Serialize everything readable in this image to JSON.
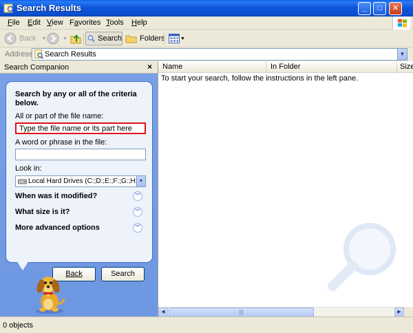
{
  "window": {
    "title": "Search Results"
  },
  "menu": {
    "items": [
      {
        "pre": "",
        "key": "F",
        "post": "ile"
      },
      {
        "pre": "",
        "key": "E",
        "post": "dit"
      },
      {
        "pre": "",
        "key": "V",
        "post": "iew"
      },
      {
        "pre": "F",
        "key": "a",
        "post": "vorites"
      },
      {
        "pre": "",
        "key": "T",
        "post": "ools"
      },
      {
        "pre": "",
        "key": "H",
        "post": "elp"
      }
    ]
  },
  "toolbar": {
    "back_label": "Back",
    "search_label": "Search",
    "folders_label": "Folders"
  },
  "address": {
    "label": "Address",
    "value": "Search Results"
  },
  "companion": {
    "title": "Search Companion",
    "close_glyph": "×",
    "heading": "Search by any or all of the criteria below.",
    "filename_label": "All or part of the file name:",
    "filename_value": "Type the file name or its part here",
    "phrase_label": "A word or phrase in the file:",
    "phrase_value": "",
    "lookin_label": "Look in:",
    "lookin_value": "Local Hard Drives (C:;D:;E:;F:;G:;H:)",
    "options": [
      "When was it modified?",
      "What size is it?",
      "More advanced options"
    ],
    "back_button": "Back",
    "search_button": "Search"
  },
  "results": {
    "columns": [
      "Name",
      "In Folder",
      "Size"
    ],
    "message": "To start your search, follow the instructions in the left pane."
  },
  "status": {
    "text": "0 objects"
  },
  "colors": {
    "titlebar": "#0a4fd0",
    "companion_bg": "#7aa1e6",
    "highlight": "#e01010"
  }
}
